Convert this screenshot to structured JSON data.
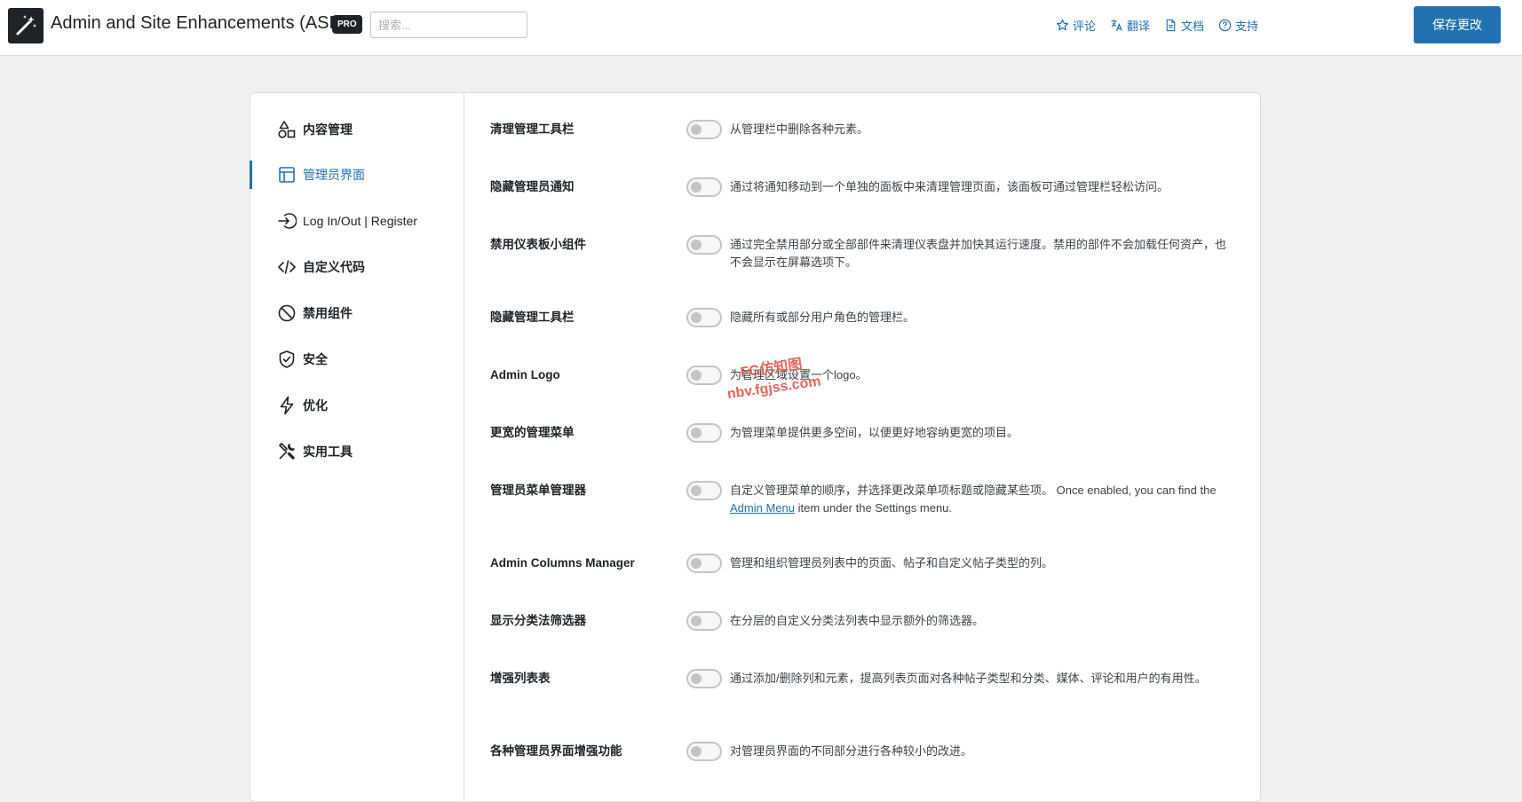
{
  "header": {
    "title": "Admin and Site Enhancements (ASE)",
    "badge": "PRO",
    "search_placeholder": "搜索...",
    "links": [
      {
        "label": "评论",
        "icon": "star-icon"
      },
      {
        "label": "翻译",
        "icon": "translate-icon"
      },
      {
        "label": "文档",
        "icon": "document-icon"
      },
      {
        "label": "支持",
        "icon": "help-icon"
      }
    ],
    "save_label": "保存更改"
  },
  "sidebar": {
    "items": [
      {
        "label": "内容管理",
        "icon": "shapes-icon",
        "active": false
      },
      {
        "label": "管理员界面",
        "icon": "layout-icon",
        "active": true
      },
      {
        "label": "Log In/Out | Register",
        "icon": "login-icon",
        "active": false
      },
      {
        "label": "自定义代码",
        "icon": "code-icon",
        "active": false
      },
      {
        "label": "禁用组件",
        "icon": "ban-icon",
        "active": false
      },
      {
        "label": "安全",
        "icon": "shield-icon",
        "active": false
      },
      {
        "label": "优化",
        "icon": "bolt-icon",
        "active": false
      },
      {
        "label": "实用工具",
        "icon": "tools-icon",
        "active": false
      }
    ]
  },
  "settings": [
    {
      "label": "清理管理工具栏",
      "desc": "从管理栏中删除各种元素。",
      "enabled": false
    },
    {
      "label": "隐藏管理员通知",
      "desc": "通过将通知移动到一个单独的面板中来清理管理页面，该面板可通过管理栏轻松访问。",
      "enabled": false
    },
    {
      "label": "禁用仪表板小组件",
      "desc": "通过完全禁用部分或全部部件来清理仪表盘并加快其运行速度。禁用的部件不会加载任何资产，也不会显示在屏幕选项下。",
      "enabled": false
    },
    {
      "label": "隐藏管理工具栏",
      "desc": "隐藏所有或部分用户角色的管理栏。",
      "enabled": false
    },
    {
      "label": "Admin Logo",
      "desc": "为管理区域设置一个logo。",
      "enabled": false
    },
    {
      "label": "更宽的管理菜单",
      "desc": "为管理菜单提供更多空间，以便更好地容纳更宽的项目。",
      "enabled": false
    },
    {
      "label": "管理员菜单管理器",
      "desc_before": "自定义管理菜单的顺序，并选择更改菜单项标题或隐藏某些项。 Once enabled, you can find the ",
      "desc_link": "Admin Menu",
      "desc_after": " item under the Settings menu.",
      "enabled": false
    },
    {
      "label": "Admin Columns Manager",
      "desc": "管理和组织管理员列表中的页面、帖子和自定义帖子类型的列。",
      "enabled": false
    },
    {
      "label": "显示分类法筛选器",
      "desc": "在分层的自定义分类法列表中显示额外的筛选器。",
      "enabled": false
    },
    {
      "label": "增强列表表",
      "desc": "通过添加/删除列和元素，提高列表页面对各种帖子类型和分类、媒体、评论和用户的有用性。",
      "enabled": false
    },
    {
      "label": "各种管理员界面增强功能",
      "desc": "对管理员界面的不同部分进行各种较小的改进。",
      "enabled": false
    }
  ],
  "watermark": {
    "line1": "FG仿知图",
    "line2": "nbv.fgjss.com"
  },
  "colors": {
    "accent": "#2271b1",
    "background": "#f0f0f1",
    "watermark": "#e2564a"
  }
}
